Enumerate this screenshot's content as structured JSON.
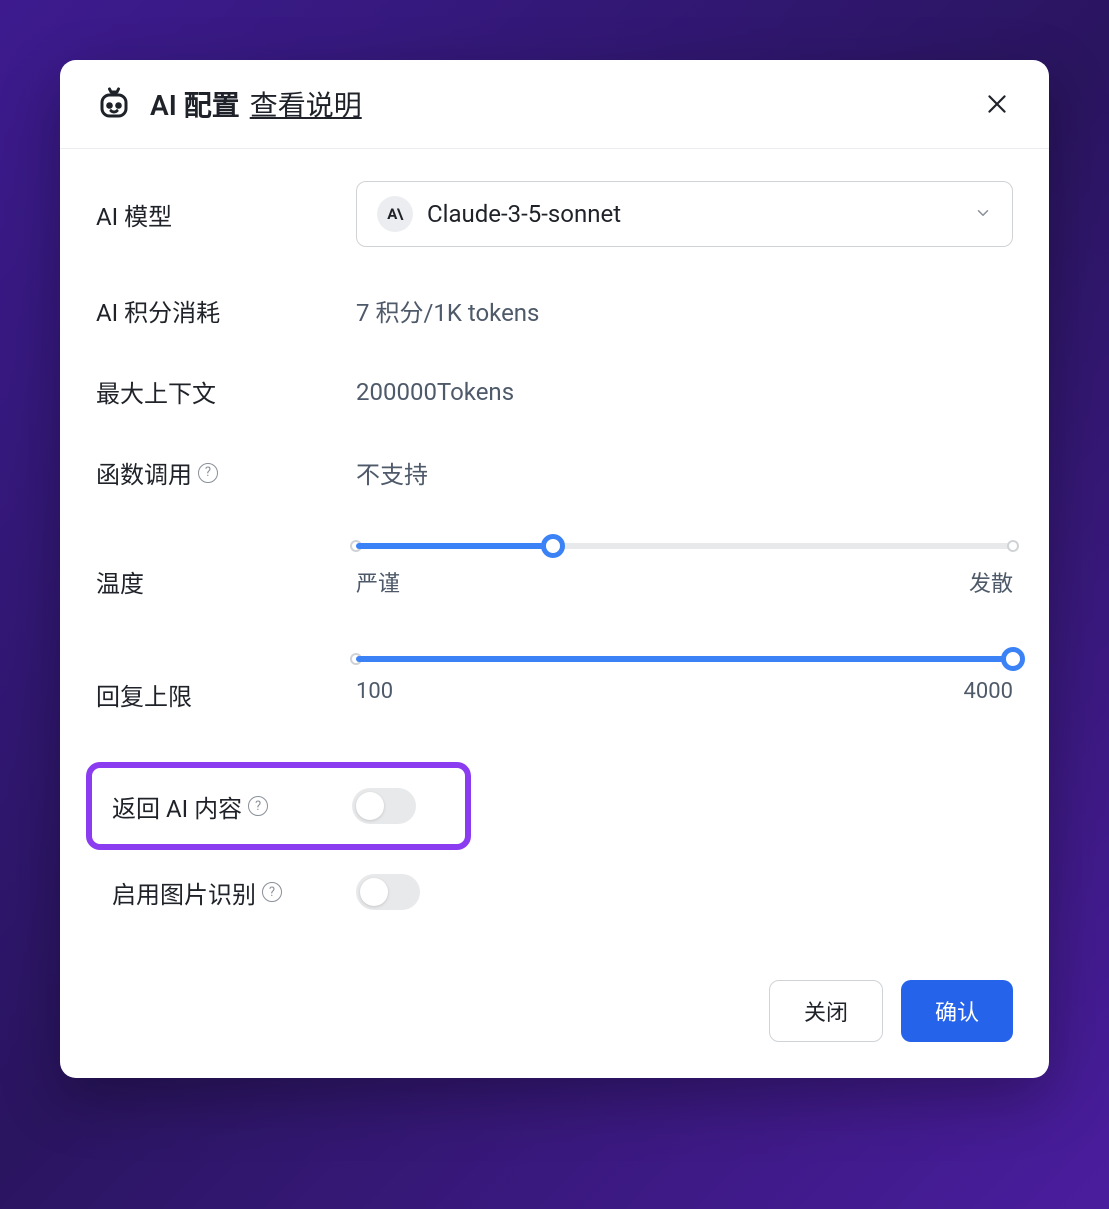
{
  "header": {
    "title": "AI 配置",
    "docs_link": "查看说明"
  },
  "fields": {
    "model": {
      "label": "AI 模型",
      "badge": "A\\",
      "value": "Claude-3-5-sonnet"
    },
    "credits": {
      "label": "AI 积分消耗",
      "value": "7 积分/1K tokens"
    },
    "context": {
      "label": "最大上下文",
      "value": "200000Tokens"
    },
    "function_call": {
      "label": "函数调用",
      "value": "不支持"
    },
    "temperature": {
      "label": "温度",
      "min_label": "严谨",
      "max_label": "发散",
      "position_pct": 30
    },
    "reply_limit": {
      "label": "回复上限",
      "min_label": "100",
      "max_label": "4000",
      "position_pct": 100
    },
    "return_ai": {
      "label": "返回 AI 内容",
      "enabled": false
    },
    "image_recognition": {
      "label": "启用图片识别",
      "enabled": false
    }
  },
  "footer": {
    "close": "关闭",
    "confirm": "确认"
  }
}
